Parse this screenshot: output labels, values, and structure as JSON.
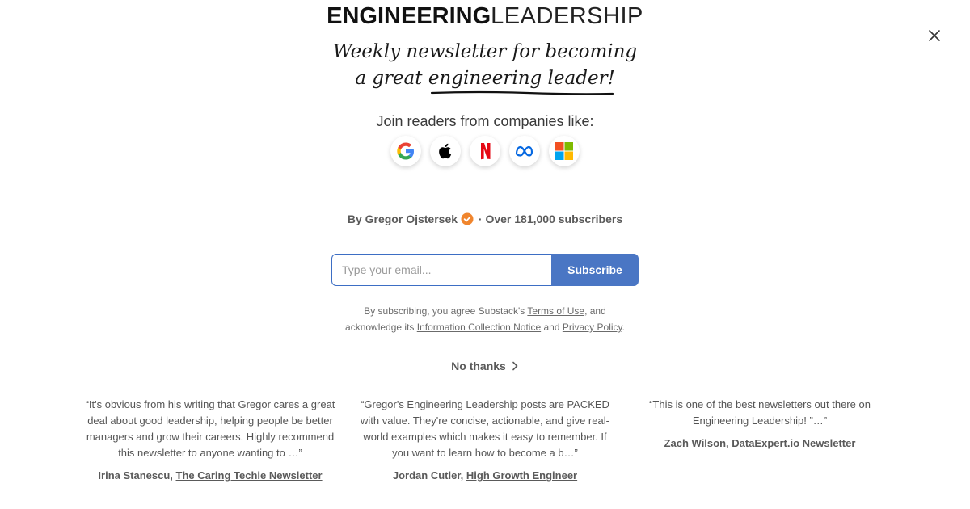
{
  "logo": {
    "bold": "ENGINEERING",
    "light": "LEADERSHIP"
  },
  "tagline": {
    "line1": "Weekly newsletter for becoming",
    "line2_prefix": "a great ",
    "line2_emph": "engineering leader!"
  },
  "join_text": "Join readers from companies like:",
  "companies": [
    {
      "name": "Google",
      "icon": "google-icon"
    },
    {
      "name": "Apple",
      "icon": "apple-icon"
    },
    {
      "name": "Netflix",
      "icon": "netflix-icon"
    },
    {
      "name": "Meta",
      "icon": "meta-icon"
    },
    {
      "name": "Microsoft",
      "icon": "microsoft-icon"
    }
  ],
  "byline": {
    "author": "By Gregor Ojstersek",
    "subscribers": "· Over 181,000 subscribers"
  },
  "form": {
    "email_placeholder": "Type your email...",
    "subscribe_label": "Subscribe"
  },
  "legal": {
    "prefix": "By subscribing, you agree Substack's ",
    "terms": "Terms of Use",
    "mid1": ", and acknowledge its ",
    "info_notice": "Information Collection Notice",
    "mid2": " and ",
    "privacy": "Privacy Policy",
    "suffix": "."
  },
  "no_thanks": "No thanks",
  "testimonials": [
    {
      "quote": "“It's obvious from his writing that Gregor cares a great deal about good leadership, helping people be better managers and grow their careers. Highly recommend this newsletter to anyone wanting to …”",
      "author": "Irina Stanescu, ",
      "publication": "The Caring Techie Newsletter"
    },
    {
      "quote": "“Gregor's Engineering Leadership posts are PACKED with value. They're concise, actionable, and give real-world examples which makes it easy to remember. If you want to learn how to become a b…”",
      "author": "Jordan Cutler, ",
      "publication": "High Growth Engineer"
    },
    {
      "quote": "“This is one of the best newsletters out there on Engineering Leadership! ”…”",
      "author": "Zach Wilson, ",
      "publication": "DataExpert.io Newsletter"
    }
  ],
  "colors": {
    "accent": "#4a76c4",
    "verified": "#f0852d",
    "text": "#5a5a5a"
  }
}
